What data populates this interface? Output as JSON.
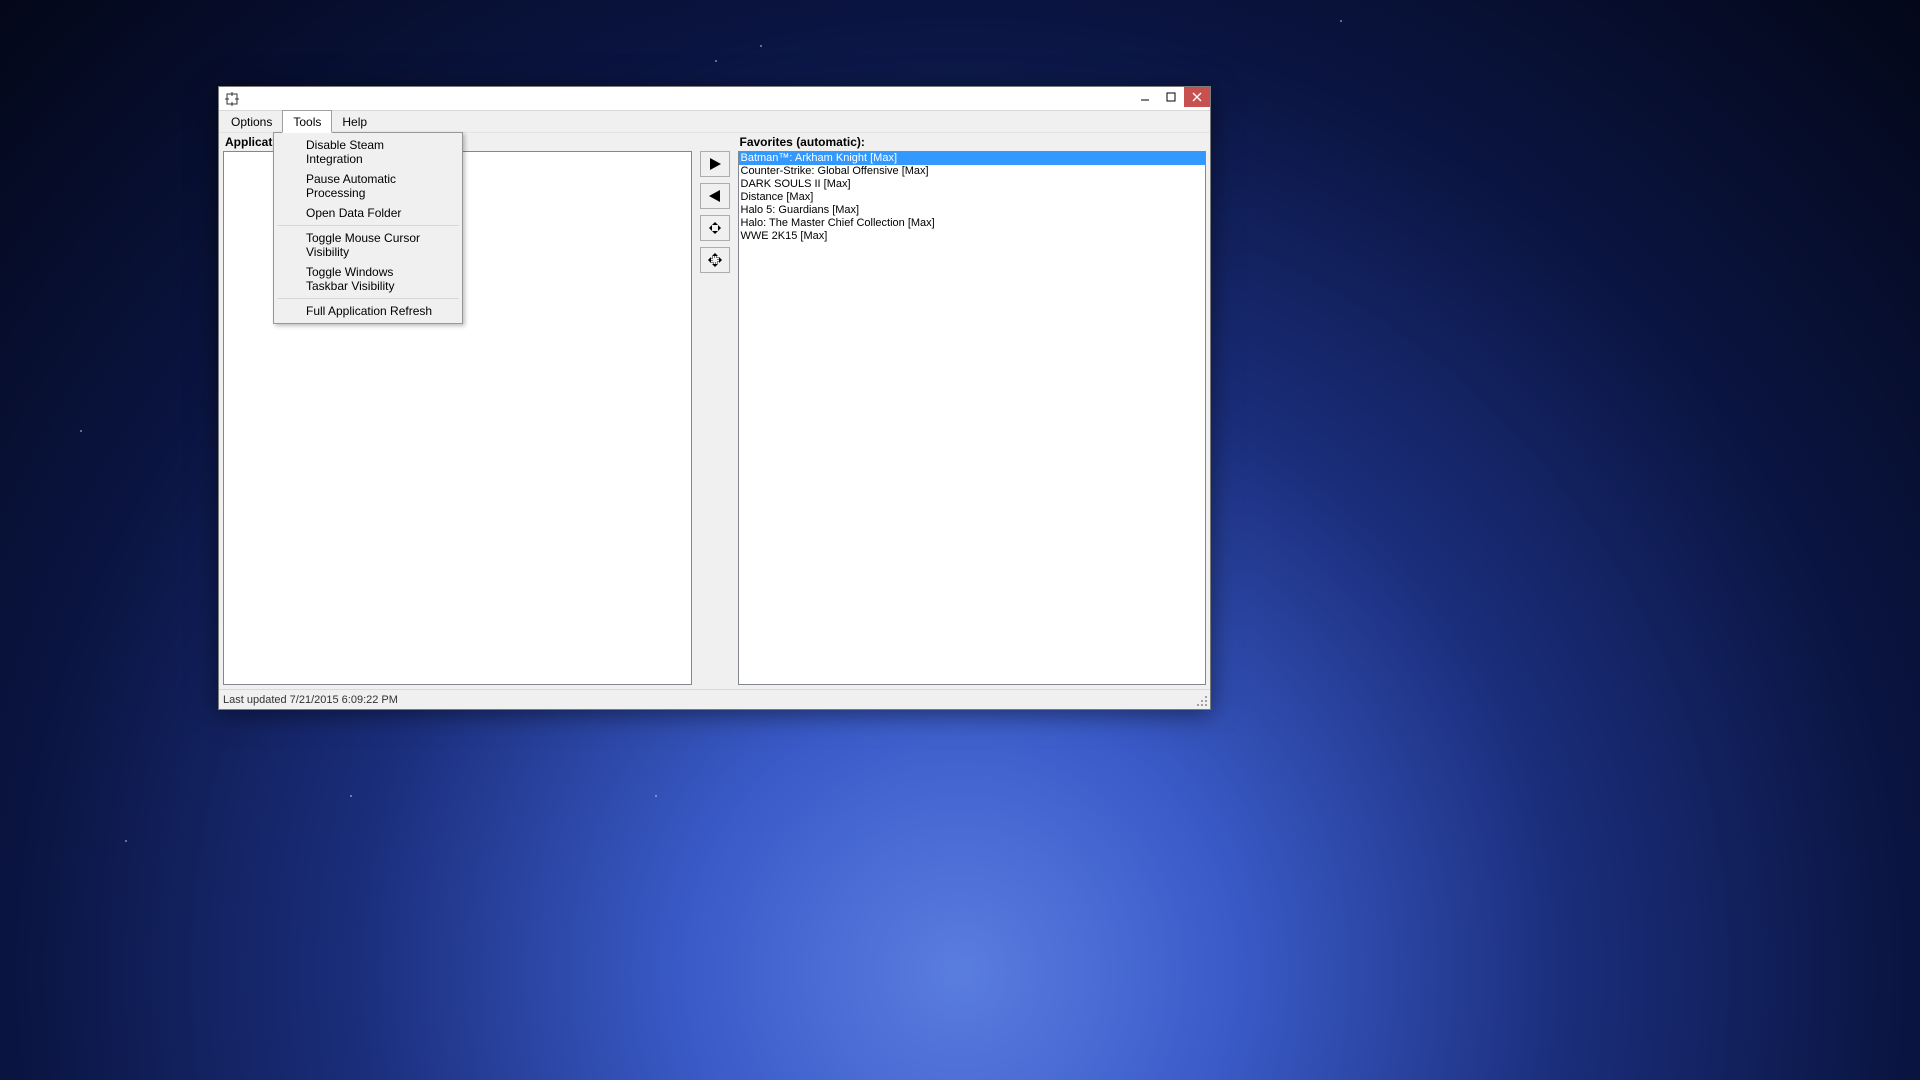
{
  "menubar": {
    "options": "Options",
    "tools": "Tools",
    "help": "Help"
  },
  "tools_menu": {
    "disable_steam": "Disable Steam Integration",
    "pause_auto": "Pause Automatic Processing",
    "open_data": "Open Data Folder",
    "toggle_cursor": "Toggle Mouse Cursor Visibility",
    "toggle_taskbar": "Toggle Windows Taskbar Visibility",
    "full_refresh": "Full Application Refresh"
  },
  "left_panel": {
    "label": "Applications:"
  },
  "right_panel": {
    "label": "Favorites (automatic):",
    "items": [
      "Batman™: Arkham Knight [Max]",
      "Counter-Strike: Global Offensive [Max]",
      "DARK SOULS II [Max]",
      "Distance [Max]",
      "Halo 5: Guardians [Max]",
      "Halo: The Master Chief Collection [Max]",
      "WWE 2K15 [Max]"
    ],
    "selected_index": 0
  },
  "statusbar": {
    "text": "Last updated 7/21/2015 6:09:22 PM"
  }
}
